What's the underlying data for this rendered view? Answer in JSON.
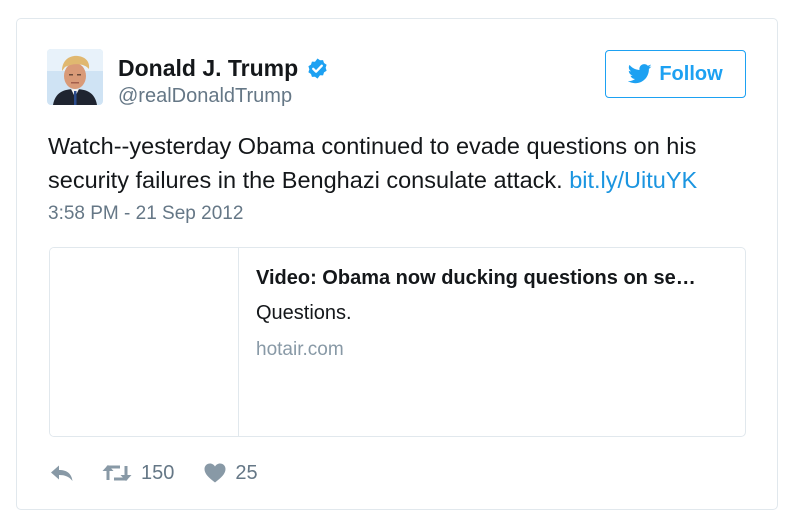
{
  "tweet": {
    "author": {
      "name": "Donald J. Trump",
      "handle": "@realDonaldTrump",
      "verified": true,
      "avatar_icon": "profile-photo"
    },
    "follow_label": "Follow",
    "text": "Watch--yesterday Obama continued to evade questions on his security failures in the Benghazi consulate attack.",
    "link_text": "bit.ly/UituYK",
    "timestamp": "3:58 PM - 21 Sep 2012",
    "card": {
      "title": "Video: Obama now ducking questions on se…",
      "description": "Questions.",
      "domain": "hotair.com"
    },
    "actions": {
      "reply_icon": "reply-icon",
      "retweet_icon": "retweet-icon",
      "like_icon": "heart-icon",
      "retweet_count": "150",
      "like_count": "25"
    }
  },
  "colors": {
    "accent": "#1da1f2",
    "link": "#1b95e0",
    "muted": "#657786",
    "border": "#e1e8ed"
  }
}
